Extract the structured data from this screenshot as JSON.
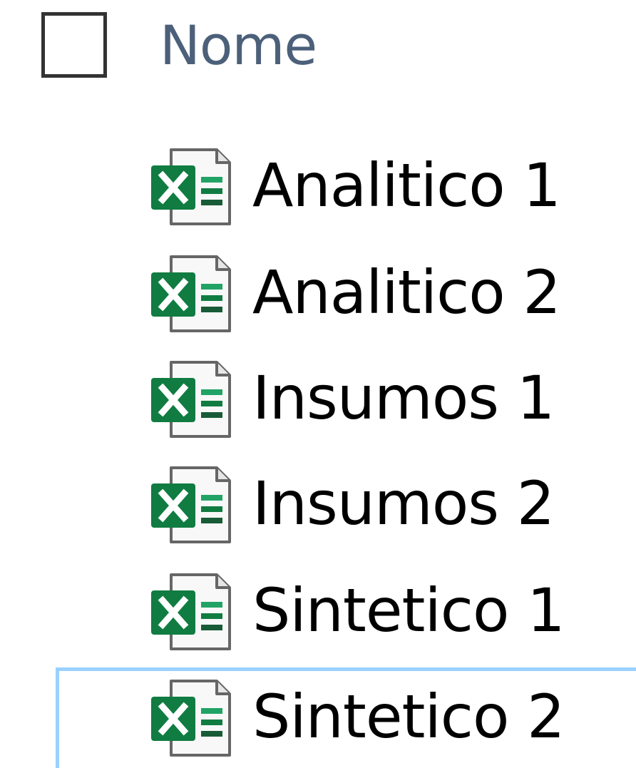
{
  "header": {
    "select_all_checked": false,
    "name_column_label": "Nome"
  },
  "files": [
    {
      "name": "Analitico 1",
      "icon": "excel-file-icon",
      "focused": false
    },
    {
      "name": "Analitico 2",
      "icon": "excel-file-icon",
      "focused": false
    },
    {
      "name": "Insumos 1",
      "icon": "excel-file-icon",
      "focused": false
    },
    {
      "name": "Insumos 2",
      "icon": "excel-file-icon",
      "focused": false
    },
    {
      "name": "Sintetico 1",
      "icon": "excel-file-icon",
      "focused": false
    },
    {
      "name": "Sintetico 2",
      "icon": "excel-file-icon",
      "focused": true
    }
  ],
  "colors": {
    "excel_green": "#107c41",
    "excel_green_light": "#21a366",
    "focus_border": "#99d1ff",
    "header_text": "#4c607a"
  }
}
